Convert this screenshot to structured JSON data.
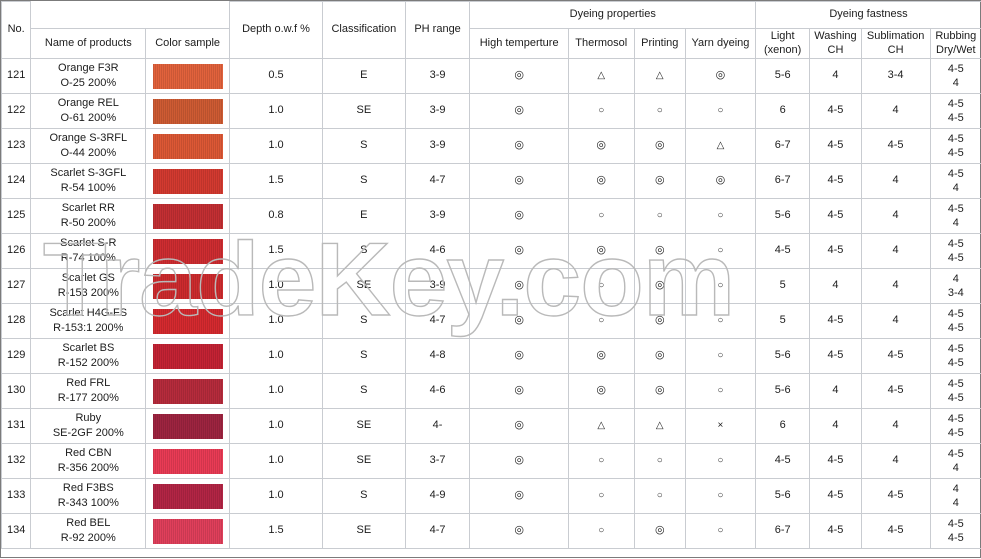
{
  "table": {
    "header": {
      "no": "No.",
      "name_of_products": "Name of products",
      "color_sample": "Color sample",
      "depth": "Depth o.w.f %",
      "classification": "Classification",
      "ph_range": "PH range",
      "dyeing_properties": "Dyeing properties",
      "dyeing_fastness": "Dyeing fastness",
      "high_temperature": "High temperture",
      "thermosol": "Thermosol",
      "printing": "Printing",
      "yarn_dyeing": "Yarn dyeing",
      "light": "Light",
      "light_sub": "(xenon)",
      "washing": "Washing",
      "washing_sub": "CH",
      "sublimation": "Sublimation",
      "sublimation_sub": "CH",
      "rubbing": "Rubbing",
      "rubbing_sub": "Dry/Wet"
    },
    "rows": [
      {
        "no": "121",
        "name": "Orange F3R",
        "code": "O-25 200%",
        "color": "#e2623c",
        "depth": "0.5",
        "classification": "E",
        "ph": "3-9",
        "high_temp": "◎",
        "thermosol": "△",
        "printing": "△",
        "yarn": "◎",
        "light": "5-6",
        "washing": "4",
        "sublimation": "3-4",
        "rub_dry": "4-5",
        "rub_wet": "4"
      },
      {
        "no": "122",
        "name": "Orange REL",
        "code": "O-61 200%",
        "color": "#ce5b33",
        "depth": "1.0",
        "classification": "SE",
        "ph": "3-9",
        "high_temp": "◎",
        "thermosol": "○",
        "printing": "○",
        "yarn": "○",
        "light": "6",
        "washing": "4-5",
        "sublimation": "4",
        "rub_dry": "4-5",
        "rub_wet": "4-5"
      },
      {
        "no": "123",
        "name": "Orange S-3RFL",
        "code": "O-44 200%",
        "color": "#dd5835",
        "depth": "1.0",
        "classification": "S",
        "ph": "3-9",
        "high_temp": "◎",
        "thermosol": "◎",
        "printing": "◎",
        "yarn": "△",
        "light": "6-7",
        "washing": "4-5",
        "sublimation": "4-5",
        "rub_dry": "4-5",
        "rub_wet": "4-5"
      },
      {
        "no": "124",
        "name": "Scarlet S-3GFL",
        "code": "R-54 100%",
        "color": "#d33a30",
        "depth": "1.5",
        "classification": "S",
        "ph": "4-7",
        "high_temp": "◎",
        "thermosol": "◎",
        "printing": "◎",
        "yarn": "◎",
        "light": "6-7",
        "washing": "4-5",
        "sublimation": "4",
        "rub_dry": "4-5",
        "rub_wet": "4"
      },
      {
        "no": "125",
        "name": "Scarlet RR",
        "code": "R-50 200%",
        "color": "#c32f33",
        "depth": "0.8",
        "classification": "E",
        "ph": "3-9",
        "high_temp": "◎",
        "thermosol": "○",
        "printing": "○",
        "yarn": "○",
        "light": "5-6",
        "washing": "4-5",
        "sublimation": "4",
        "rub_dry": "4-5",
        "rub_wet": "4"
      },
      {
        "no": "126",
        "name": "Scarlet S-R",
        "code": "R-74 100%",
        "color": "#ce2d31",
        "depth": "1.5",
        "classification": "S",
        "ph": "4-6",
        "high_temp": "◎",
        "thermosol": "◎",
        "printing": "◎",
        "yarn": "○",
        "light": "4-5",
        "washing": "4-5",
        "sublimation": "4",
        "rub_dry": "4-5",
        "rub_wet": "4-5"
      },
      {
        "no": "127",
        "name": "Scarlet GS",
        "code": "R-153 200%",
        "color": "#cd2b2e",
        "depth": "1.0",
        "classification": "SE",
        "ph": "3-9",
        "high_temp": "◎",
        "thermosol": "○",
        "printing": "◎",
        "yarn": "○",
        "light": "5",
        "washing": "4",
        "sublimation": "4",
        "rub_dry": "4",
        "rub_wet": "3-4"
      },
      {
        "no": "128",
        "name": "Scarlet H4G-FS",
        "code": "R-153:1 200%",
        "color": "#d52a2f",
        "depth": "1.0",
        "classification": "S",
        "ph": "4-7",
        "high_temp": "◎",
        "thermosol": "○",
        "printing": "◎",
        "yarn": "○",
        "light": "5",
        "washing": "4-5",
        "sublimation": "4",
        "rub_dry": "4-5",
        "rub_wet": "4-5"
      },
      {
        "no": "129",
        "name": "Scarlet BS",
        "code": "R-152 200%",
        "color": "#c42334",
        "depth": "1.0",
        "classification": "S",
        "ph": "4-8",
        "high_temp": "◎",
        "thermosol": "◎",
        "printing": "◎",
        "yarn": "○",
        "light": "5-6",
        "washing": "4-5",
        "sublimation": "4-5",
        "rub_dry": "4-5",
        "rub_wet": "4-5"
      },
      {
        "no": "130",
        "name": "Red FRL",
        "code": "R-177 200%",
        "color": "#b62b3c",
        "depth": "1.0",
        "classification": "S",
        "ph": "4-6",
        "high_temp": "◎",
        "thermosol": "◎",
        "printing": "◎",
        "yarn": "○",
        "light": "5-6",
        "washing": "4",
        "sublimation": "4-5",
        "rub_dry": "4-5",
        "rub_wet": "4-5"
      },
      {
        "no": "131",
        "name": "Ruby",
        "code": "SE-2GF 200%",
        "color": "#9e2440",
        "depth": "1.0",
        "classification": "SE",
        "ph": "4-",
        "high_temp": "◎",
        "thermosol": "△",
        "printing": "△",
        "yarn": "×",
        "light": "6",
        "washing": "4",
        "sublimation": "4",
        "rub_dry": "4-5",
        "rub_wet": "4-5"
      },
      {
        "no": "132",
        "name": "Red CBN",
        "code": "R-356 200%",
        "color": "#e93b55",
        "depth": "1.0",
        "classification": "SE",
        "ph": "3-7",
        "high_temp": "◎",
        "thermosol": "○",
        "printing": "○",
        "yarn": "○",
        "light": "4-5",
        "washing": "4-5",
        "sublimation": "4",
        "rub_dry": "4-5",
        "rub_wet": "4"
      },
      {
        "no": "133",
        "name": "Red F3BS",
        "code": "R-343 100%",
        "color": "#b32545",
        "depth": "1.0",
        "classification": "S",
        "ph": "4-9",
        "high_temp": "◎",
        "thermosol": "○",
        "printing": "○",
        "yarn": "○",
        "light": "5-6",
        "washing": "4-5",
        "sublimation": "4-5",
        "rub_dry": "4",
        "rub_wet": "4"
      },
      {
        "no": "134",
        "name": "Red BEL",
        "code": "R-92 200%",
        "color": "#e03f5b",
        "depth": "1.5",
        "classification": "SE",
        "ph": "4-7",
        "high_temp": "◎",
        "thermosol": "○",
        "printing": "◎",
        "yarn": "○",
        "light": "6-7",
        "washing": "4-5",
        "sublimation": "4-5",
        "rub_dry": "4-5",
        "rub_wet": "4-5"
      }
    ]
  },
  "watermark": {
    "text": "TradeKey.com",
    "stroke_color": "#b9b9b9"
  }
}
